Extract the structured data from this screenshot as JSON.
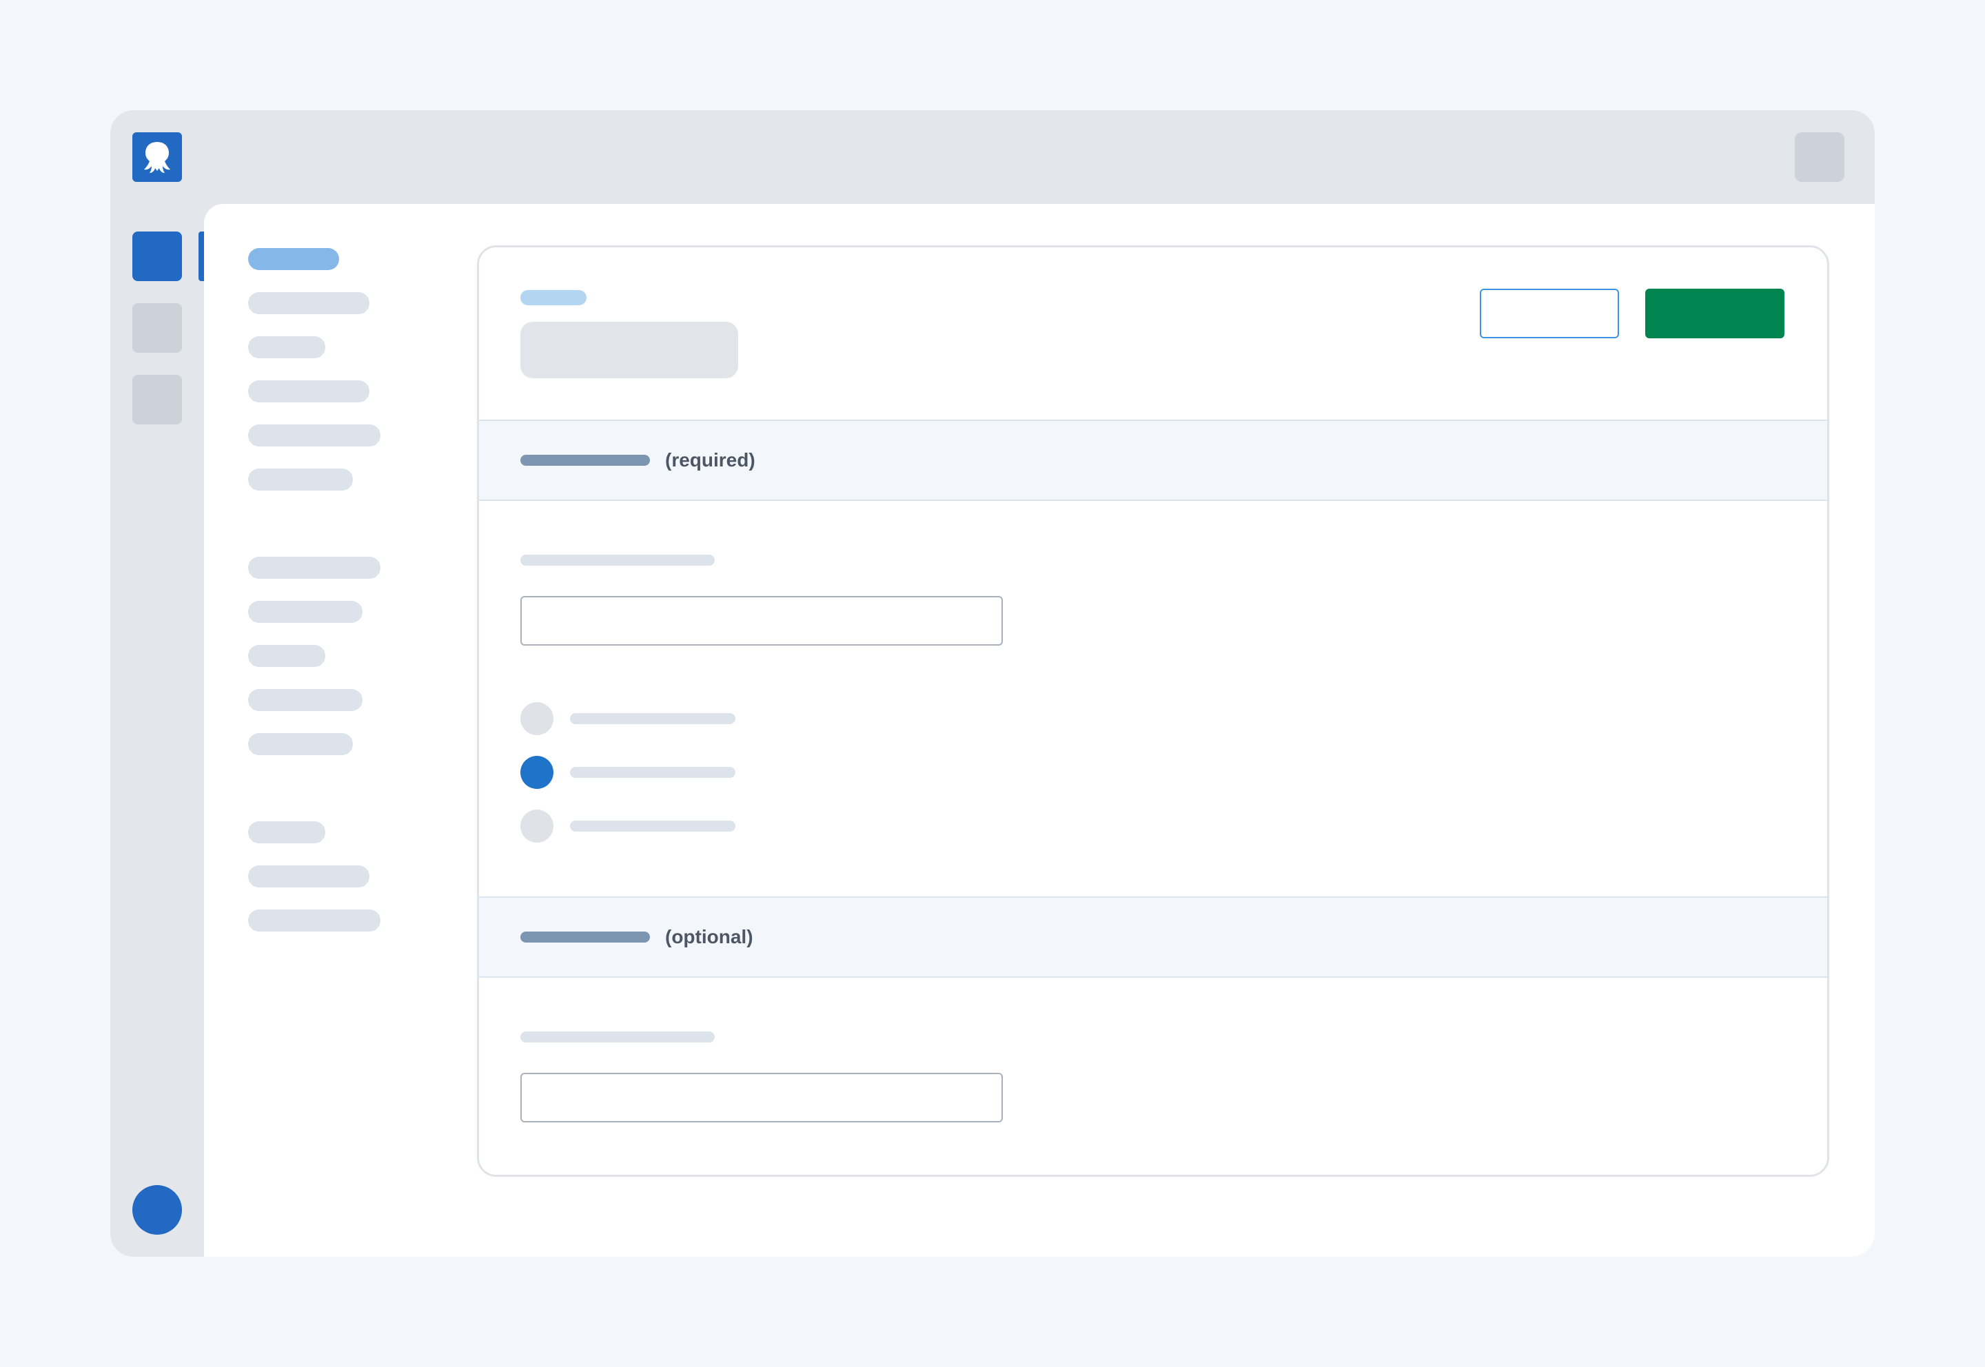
{
  "colors": {
    "page_bg": "#f3f7fb",
    "chrome": "#e3e7ec",
    "brand_blue": "#2169c2",
    "placeholder_gray": "#cdd2da",
    "skeleton": "#dde3ea",
    "skeleton_active": "#85b7e8",
    "eyebrow": "#b4d5f1",
    "title_block": "#e1e4e8",
    "section_bg": "#f3f7fb",
    "section_bar": "#7d95b0",
    "outline_button_border": "#3a94e0",
    "primary_button": "#008550",
    "radio_off": "#dfe3e8",
    "radio_on": "#1f74c9"
  },
  "app": {
    "logo_icon": "octopus-logo-icon"
  },
  "sections": {
    "required": {
      "label": "(required)"
    },
    "optional": {
      "label": "(optional)"
    }
  },
  "radio_group": {
    "selected_index": 1,
    "count": 3
  }
}
